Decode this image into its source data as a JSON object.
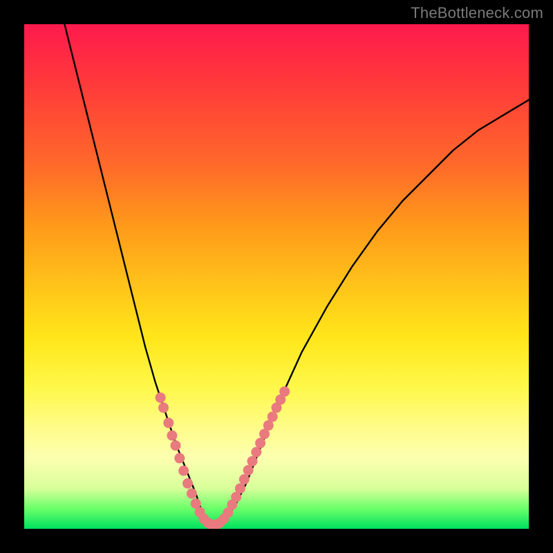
{
  "watermark": {
    "text": "TheBottleneck.com"
  },
  "chart_data": {
    "type": "line",
    "title": "",
    "xlabel": "",
    "ylabel": "",
    "xlim": [
      0,
      100
    ],
    "ylim": [
      0,
      100
    ],
    "grid": false,
    "series": [
      {
        "name": "bottleneck-curve",
        "x": [
          8,
          10,
          12,
          14,
          16,
          18,
          20,
          22,
          24,
          26,
          28,
          30,
          32,
          34,
          35,
          36,
          37,
          38,
          40,
          42,
          44,
          46,
          48,
          50,
          55,
          60,
          65,
          70,
          75,
          80,
          85,
          90,
          95,
          100
        ],
        "y": [
          100,
          92,
          84,
          76,
          68,
          60,
          52,
          44,
          36,
          29,
          23,
          17,
          12,
          7,
          4,
          2,
          1,
          1,
          2,
          5,
          9,
          14,
          19,
          24,
          35,
          44,
          52,
          59,
          65,
          70,
          75,
          79,
          82,
          85
        ]
      }
    ],
    "markers": [
      {
        "name": "pink-dots",
        "color": "#e97a7e",
        "points": [
          {
            "x": 27.0,
            "y": 26.0
          },
          {
            "x": 27.6,
            "y": 24.0
          },
          {
            "x": 28.6,
            "y": 21.0
          },
          {
            "x": 29.3,
            "y": 18.5
          },
          {
            "x": 30.0,
            "y": 16.5
          },
          {
            "x": 30.8,
            "y": 14.0
          },
          {
            "x": 31.6,
            "y": 11.5
          },
          {
            "x": 32.4,
            "y": 9.0
          },
          {
            "x": 33.2,
            "y": 7.0
          },
          {
            "x": 34.0,
            "y": 5.0
          },
          {
            "x": 34.8,
            "y": 3.3
          },
          {
            "x": 35.6,
            "y": 2.0
          },
          {
            "x": 36.4,
            "y": 1.2
          },
          {
            "x": 37.2,
            "y": 0.8
          },
          {
            "x": 38.0,
            "y": 0.8
          },
          {
            "x": 38.8,
            "y": 1.2
          },
          {
            "x": 39.6,
            "y": 2.0
          },
          {
            "x": 40.4,
            "y": 3.2
          },
          {
            "x": 41.2,
            "y": 4.8
          },
          {
            "x": 42.0,
            "y": 6.3
          },
          {
            "x": 42.8,
            "y": 8.0
          },
          {
            "x": 43.6,
            "y": 9.8
          },
          {
            "x": 44.4,
            "y": 11.6
          },
          {
            "x": 45.2,
            "y": 13.4
          },
          {
            "x": 46.0,
            "y": 15.2
          },
          {
            "x": 46.8,
            "y": 17.0
          },
          {
            "x": 47.6,
            "y": 18.8
          },
          {
            "x": 48.4,
            "y": 20.5
          },
          {
            "x": 49.2,
            "y": 22.2
          },
          {
            "x": 50.0,
            "y": 24.0
          },
          {
            "x": 50.8,
            "y": 25.6
          },
          {
            "x": 51.6,
            "y": 27.2
          }
        ]
      }
    ],
    "background_gradient": {
      "top": "#ff1a4d",
      "bottom": "#00e060"
    }
  }
}
